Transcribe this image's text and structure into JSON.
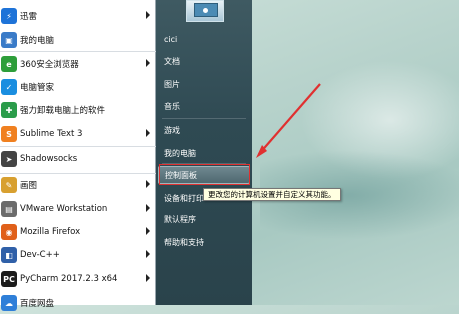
{
  "left_apps": [
    {
      "label": "迅雷",
      "icon": "thunder-icon",
      "color": "#1e73d8",
      "glyph": "⚡",
      "arrow": true
    },
    {
      "label": "我的电脑",
      "icon": "computer-icon",
      "color": "#3a7bc8",
      "glyph": "▣",
      "arrow": false
    },
    {
      "label": "360安全浏览器",
      "icon": "browser-360-icon",
      "color": "#2e9e3a",
      "glyph": "e",
      "arrow": true
    },
    {
      "label": "电脑管家",
      "icon": "shield-icon",
      "color": "#1a8ee0",
      "glyph": "✓",
      "arrow": false
    },
    {
      "label": "强力卸载电脑上的软件",
      "icon": "uninstall-icon",
      "color": "#2a9c4a",
      "glyph": "✚",
      "arrow": false
    },
    {
      "label": "Sublime Text 3",
      "icon": "sublime-icon",
      "color": "#f08020",
      "glyph": "S",
      "arrow": true
    },
    {
      "label": "Shadowsocks",
      "icon": "paper-plane-icon",
      "color": "#444444",
      "glyph": "➤",
      "arrow": false
    },
    {
      "label": "画图",
      "icon": "paint-icon",
      "color": "#d8a030",
      "glyph": "✎",
      "arrow": true
    },
    {
      "label": "VMware Workstation",
      "icon": "vmware-icon",
      "color": "#6b6b6b",
      "glyph": "▤",
      "arrow": true
    },
    {
      "label": "Mozilla Firefox",
      "icon": "firefox-icon",
      "color": "#e0601a",
      "glyph": "◉",
      "arrow": true
    },
    {
      "label": "Dev-C++",
      "icon": "devcpp-icon",
      "color": "#3060a8",
      "glyph": "◧",
      "arrow": true
    },
    {
      "label": "PyCharm 2017.2.3 x64",
      "icon": "pycharm-icon",
      "color": "#1c1c1c",
      "glyph": "PC",
      "arrow": true
    },
    {
      "label": "百度网盘",
      "icon": "cloud-icon",
      "color": "#2f7fd8",
      "glyph": "☁",
      "arrow": false
    }
  ],
  "right_items": [
    {
      "label": "cici"
    },
    {
      "label": "文档"
    },
    {
      "label": "图片"
    },
    {
      "label": "音乐"
    },
    {
      "label": "游戏"
    },
    {
      "label": "我的电脑"
    },
    {
      "label": "控制面板"
    },
    {
      "label": "设备和打印"
    },
    {
      "label": "默认程序"
    },
    {
      "label": "帮助和支持"
    }
  ],
  "tooltip": "更改您的计算机设置并自定义其功能。",
  "colors": {
    "annotation": "#e03030"
  }
}
